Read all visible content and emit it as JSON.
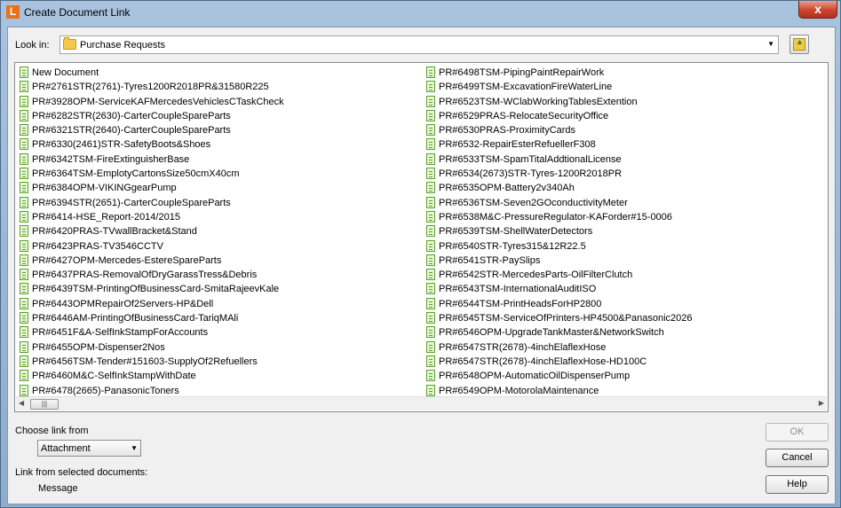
{
  "window": {
    "app_icon": "L",
    "title": "Create Document Link",
    "close_glyph": "x"
  },
  "look_in": {
    "label": "Look in:",
    "value": "Purchase Requests"
  },
  "files": {
    "column1": [
      "New Document",
      "PR#2761STR(2761)-Tyres1200R2018PR&31580R225",
      "PR#3928OPM-ServiceKAFMercedesVehiclesCTaskCheck",
      "PR#6282STR(2630)-CarterCoupleSpareParts",
      "PR#6321STR(2640)-CarterCoupleSpareParts",
      "PR#6330(2461)STR-SafetyBoots&Shoes",
      "PR#6342TSM-FireExtinguisherBase",
      "PR#6364TSM-EmplotyCartonsSize50cmX40cm",
      "PR#6384OPM-VIKINGgearPump",
      "PR#6394STR(2651)-CarterCoupleSpareParts",
      "PR#6414-HSE_Report-2014/2015",
      "PR#6420PRAS-TVwallBracket&Stand",
      "PR#6423PRAS-TV3546CCTV",
      "PR#6427OPM-Mercedes-EstereSpareParts",
      "PR#6437PRAS-RemovalOfDryGarassTress&Debris",
      "PR#6439TSM-PrintingOfBusinessCard-SmitaRajeevKale",
      "PR#6443OPMRepairOf2Servers-HP&Dell",
      "PR#6446AM-PrintingOfBusinessCard-TariqMAli",
      "PR#6451F&A-SelfInkStampForAccounts",
      "PR#6455OPM-Dispenser2Nos",
      "PR#6456TSM-Tender#151603-SupplyOf2Refuellers",
      "PR#6460M&C-SelfInkStampWithDate",
      "PR#6478(2665)-PanasonicToners"
    ],
    "column2": [
      "PR#6498TSM-PipingPaintRepairWork",
      "PR#6499TSM-ExcavationFireWaterLine",
      "PR#6523TSM-WClabWorkingTablesExtention",
      "PR#6529PRAS-RelocateSecurityOffice",
      "PR#6530PRAS-ProximityCards",
      "PR#6532-RepairEsterRefuellerF308",
      "PR#6533TSM-SpamTitalAddtionalLicense",
      "PR#6534(2673)STR-Tyres-1200R2018PR",
      "PR#6535OPM-Battery2v340Ah",
      "PR#6536TSM-Seven2GOconductivityMeter",
      "PR#6538M&C-PressureRegulator-KAForder#15-0006",
      "PR#6539TSM-ShellWaterDetectors",
      "PR#6540STR-Tyres315&12R22.5",
      "PR#6541STR-PaySlips",
      "PR#6542STR-MercedesParts-OilFilterClutch",
      "PR#6543TSM-InternationalAuditISO",
      "PR#6544TSM-PrintHeadsForHP2800",
      "PR#6545TSM-ServiceOfPrinters-HP4500&Panasonic2026",
      "PR#6546OPM-UpgradeTankMaster&NetworkSwitch",
      "PR#6547STR(2678)-4inchElaflexHose",
      "PR#6547STR(2678)-4inchElaflexHose-HD100C",
      "PR#6548OPM-AutomaticOilDispenserPump",
      "PR#6549OPM-MotorolaMaintenance"
    ]
  },
  "scrollbar": {
    "thumb_grip": "|||"
  },
  "choose_link": {
    "label": "Choose link from",
    "value": "Attachment"
  },
  "link_from_selected": {
    "label": "Link from selected documents:",
    "value": "Message"
  },
  "buttons": {
    "ok": "OK",
    "cancel": "Cancel",
    "help": "Help"
  },
  "colors": {
    "doc_icon_green": "#5aa02c",
    "folder_yellow": "#f2c94c",
    "close_red": "#c9452f"
  }
}
